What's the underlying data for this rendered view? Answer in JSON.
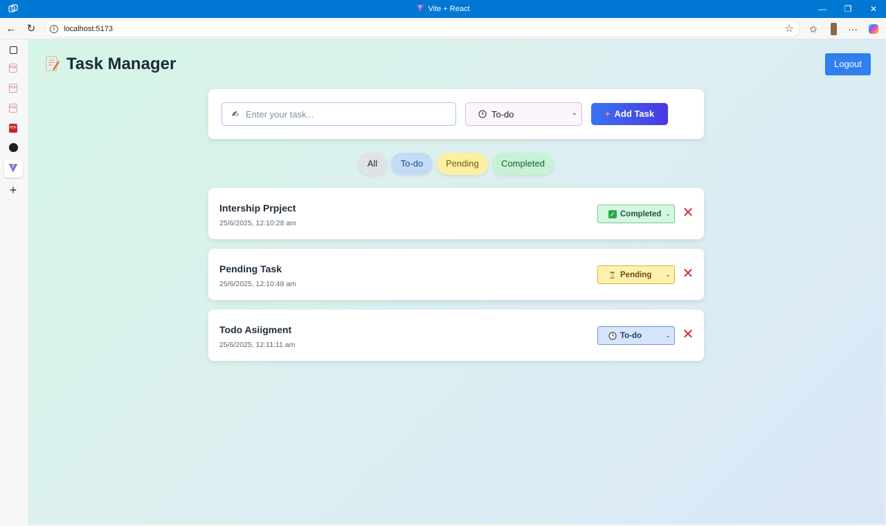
{
  "window": {
    "title": "Vite + React"
  },
  "browser": {
    "url": "localhost:5173"
  },
  "app": {
    "title": "Task Manager",
    "logout_label": "Logout"
  },
  "add_form": {
    "input_placeholder": "Enter your task...",
    "status_value": "To-do",
    "add_label": "Add Task"
  },
  "filters": [
    {
      "label": "All"
    },
    {
      "label": "To-do"
    },
    {
      "label": "Pending"
    },
    {
      "label": "Completed"
    }
  ],
  "tasks": [
    {
      "title": "Intership Prpject",
      "date": "25/6/2025, 12:10:28 am",
      "status": "Completed",
      "status_icon": "check-box-icon"
    },
    {
      "title": "Pending Task",
      "date": "25/6/2025, 12:10:48 am",
      "status": "Pending",
      "status_icon": "hourglass-icon"
    },
    {
      "title": "Todo Asiigment",
      "date": "25/6/2025, 12:11:11 am",
      "status": "To-do",
      "status_icon": "clock-icon"
    }
  ],
  "colors": {
    "titlebar": "#0078d4",
    "logout": "#2f7fee",
    "delete": "#d4252f"
  }
}
